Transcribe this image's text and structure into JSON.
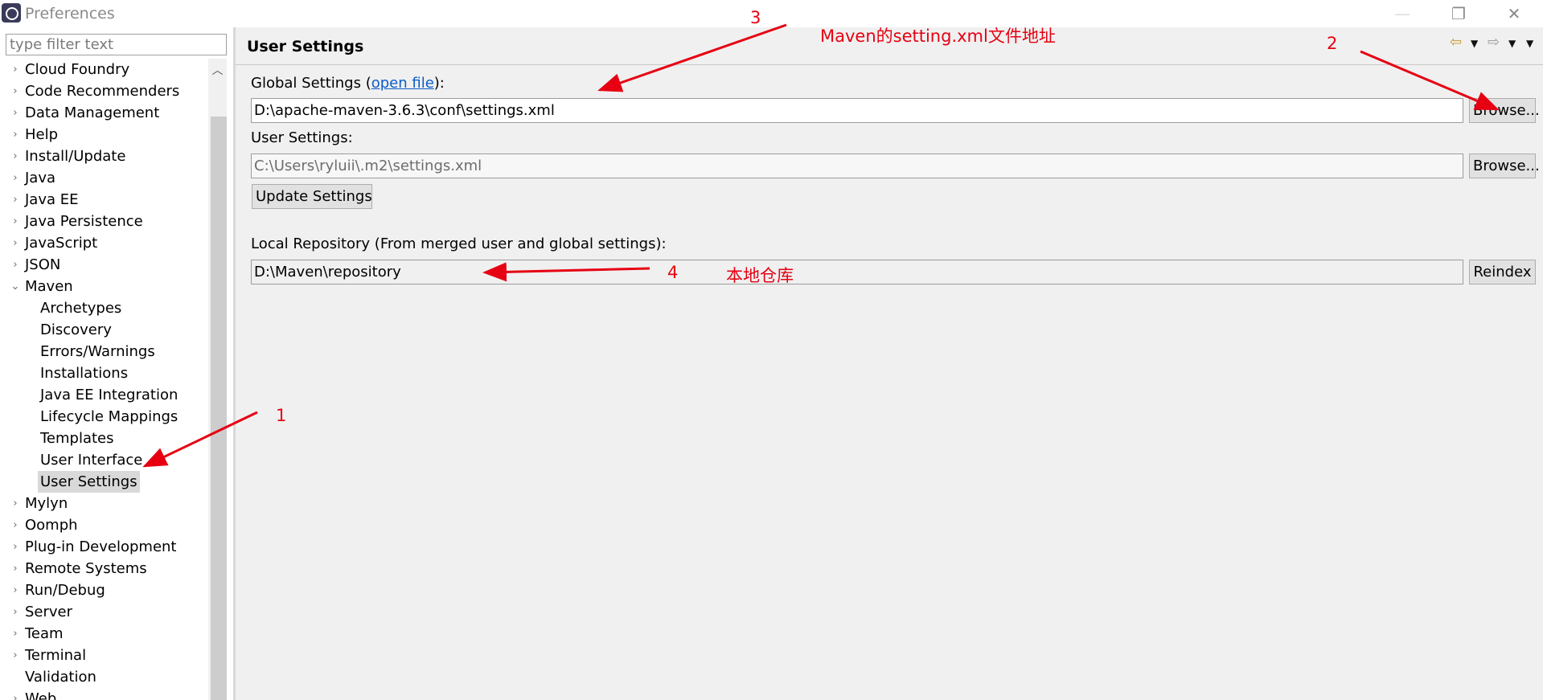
{
  "window": {
    "title": "Preferences",
    "controls": {
      "minimize": "—",
      "maximize": "❐",
      "close": "✕"
    }
  },
  "sidebar": {
    "filter_placeholder": "type filter text",
    "items": [
      {
        "label": "Cloud Foundry",
        "level": 0,
        "arrow": "›"
      },
      {
        "label": "Code Recommenders",
        "level": 0,
        "arrow": "›"
      },
      {
        "label": "Data Management",
        "level": 0,
        "arrow": "›"
      },
      {
        "label": "Help",
        "level": 0,
        "arrow": "›"
      },
      {
        "label": "Install/Update",
        "level": 0,
        "arrow": "›"
      },
      {
        "label": "Java",
        "level": 0,
        "arrow": "›"
      },
      {
        "label": "Java EE",
        "level": 0,
        "arrow": "›"
      },
      {
        "label": "Java Persistence",
        "level": 0,
        "arrow": "›"
      },
      {
        "label": "JavaScript",
        "level": 0,
        "arrow": "›"
      },
      {
        "label": "JSON",
        "level": 0,
        "arrow": "›"
      },
      {
        "label": "Maven",
        "level": 0,
        "arrow": "⌄"
      },
      {
        "label": "Archetypes",
        "level": 1,
        "arrow": ""
      },
      {
        "label": "Discovery",
        "level": 1,
        "arrow": ""
      },
      {
        "label": "Errors/Warnings",
        "level": 1,
        "arrow": ""
      },
      {
        "label": "Installations",
        "level": 1,
        "arrow": ""
      },
      {
        "label": "Java EE Integration",
        "level": 1,
        "arrow": ""
      },
      {
        "label": "Lifecycle Mappings",
        "level": 1,
        "arrow": ""
      },
      {
        "label": "Templates",
        "level": 1,
        "arrow": ""
      },
      {
        "label": "User Interface",
        "level": 1,
        "arrow": ""
      },
      {
        "label": "User Settings",
        "level": 1,
        "arrow": "",
        "selected": true
      },
      {
        "label": "Mylyn",
        "level": 0,
        "arrow": "›"
      },
      {
        "label": "Oomph",
        "level": 0,
        "arrow": "›"
      },
      {
        "label": "Plug-in Development",
        "level": 0,
        "arrow": "›"
      },
      {
        "label": "Remote Systems",
        "level": 0,
        "arrow": "›"
      },
      {
        "label": "Run/Debug",
        "level": 0,
        "arrow": "›"
      },
      {
        "label": "Server",
        "level": 0,
        "arrow": "›"
      },
      {
        "label": "Team",
        "level": 0,
        "arrow": "›"
      },
      {
        "label": "Terminal",
        "level": 0,
        "arrow": "›"
      },
      {
        "label": "Validation",
        "level": 0,
        "arrow": ""
      },
      {
        "label": "Web",
        "level": 0,
        "arrow": "›"
      }
    ]
  },
  "main": {
    "title": "User Settings",
    "global_settings": {
      "label_prefix": "Global Settings (",
      "link": "open file",
      "label_suffix": "):",
      "value": "D:\\apache-maven-3.6.3\\conf\\settings.xml",
      "browse": "Browse..."
    },
    "user_settings": {
      "label": "User Settings:",
      "value": "C:\\Users\\ryluii\\.m2\\settings.xml",
      "browse": "Browse..."
    },
    "update_button": "Update Settings",
    "local_repository": {
      "label": "Local Repository (From merged user and global settings):",
      "value": "D:\\Maven\\repository",
      "reindex": "Reindex"
    }
  },
  "annotations": {
    "color": "#e60012",
    "n1": "1",
    "n2": "2",
    "n3": "3",
    "n3_text": "Maven的setting.xml文件地址",
    "n4": "4",
    "n4_text": "本地仓库"
  }
}
